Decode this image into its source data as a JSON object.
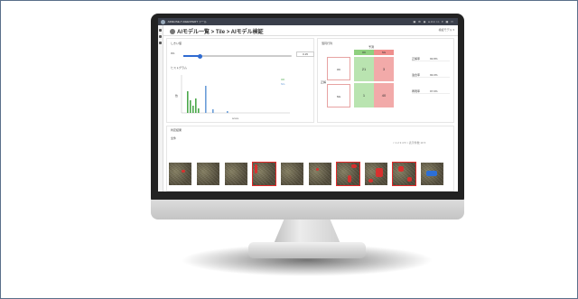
{
  "app": {
    "window_title": "AIREUSE-T AIEEXPERT ツール",
    "page_title": "AIモデル一覧 > Tile > AIモデル検証",
    "header_right": "検証モデル ▾",
    "topbar_right": "▣ ⚙ ◉ admin ▾ ▦ ▭"
  },
  "threshold": {
    "label": "しきい値",
    "min_label": "0%",
    "value": 0.15,
    "value_text": "0.15",
    "max_label": "1"
  },
  "histogram": {
    "label": "ヒストグラム",
    "legend": [
      "OK",
      "NG"
    ],
    "x_label": "score",
    "y_label": "数"
  },
  "confusion": {
    "label": "混同行列",
    "header": "予測",
    "col_headers": [
      "OK",
      "NG"
    ],
    "row_headers": [
      "OK",
      "NG"
    ],
    "side_label": "正解",
    "cells": [
      [
        "21",
        "3"
      ],
      [
        "1",
        "40"
      ]
    ],
    "colors": {
      "good": "#b9e4b0",
      "bad": "#f2aaa9",
      "header_ok": "#8fd07f",
      "header_ng": "#ef8f8d"
    }
  },
  "metrics": [
    {
      "label": "正解率",
      "value": "93.8%"
    },
    {
      "label": "適合率",
      "value": "93.0%"
    },
    {
      "label": "再現率",
      "value": "97.6%"
    }
  ],
  "results": {
    "section_label": "判定結果",
    "filter_label": "全件",
    "pager": "< 1 2 3 4 5 >  表示件数 10 ▾"
  },
  "thumbnails": [
    {
      "marks": [
        [
          14,
          8,
          4,
          3
        ]
      ],
      "selected": false,
      "blue": false
    },
    {
      "marks": [],
      "selected": false,
      "blue": false
    },
    {
      "marks": [],
      "selected": false,
      "blue": false
    },
    {
      "marks": [
        [
          2,
          2,
          3,
          10
        ]
      ],
      "selected": true,
      "blue": false
    },
    {
      "marks": [],
      "selected": false,
      "blue": false
    },
    {
      "marks": [
        [
          8,
          6,
          3,
          3
        ]
      ],
      "selected": false,
      "blue": false
    },
    {
      "marks": [
        [
          16,
          2,
          6,
          4
        ],
        [
          12,
          14,
          4,
          8
        ]
      ],
      "selected": true,
      "blue": false
    },
    {
      "marks": [
        [
          12,
          6,
          8,
          10
        ],
        [
          4,
          18,
          5,
          4
        ]
      ],
      "selected": false,
      "blue": false
    },
    {
      "marks": [
        [
          6,
          4,
          6,
          6
        ],
        [
          16,
          16,
          5,
          5
        ]
      ],
      "selected": true,
      "blue": false
    },
    {
      "marks": [],
      "selected": false,
      "blue": true
    }
  ]
}
